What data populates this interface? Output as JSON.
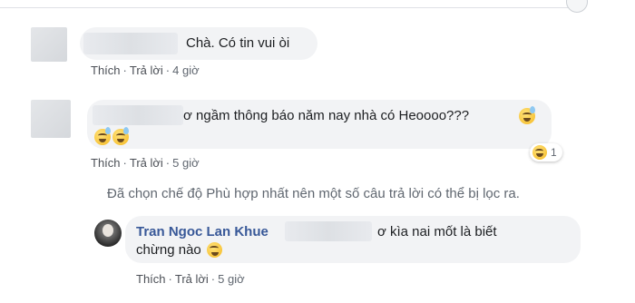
{
  "comments": [
    {
      "text": "Chà. Có tin vui òi",
      "actions": {
        "like": "Thích",
        "reply": "Trả lời",
        "time": "4 giờ"
      }
    },
    {
      "text": "ơ ngầm thông báo năm nay nhà có Heoooo???",
      "emoji": "sweat-smile-emoji",
      "reaction_count": "1",
      "actions": {
        "like": "Thích",
        "reply": "Trả lời",
        "time": "5 giờ"
      }
    }
  ],
  "filter_notice": "Đã chọn chế độ Phù hợp nhất nên một số câu trả lời có thể bị lọc ra.",
  "reply": {
    "author": "Tran Ngoc Lan Khue",
    "text_part1": "ơ kìa nai mốt là biết",
    "text_part2": "chừng nào",
    "emoji": "laughing-emoji",
    "actions": {
      "like": "Thích",
      "reply": "Trả lời",
      "time": "5 giờ"
    }
  },
  "separator": "·"
}
